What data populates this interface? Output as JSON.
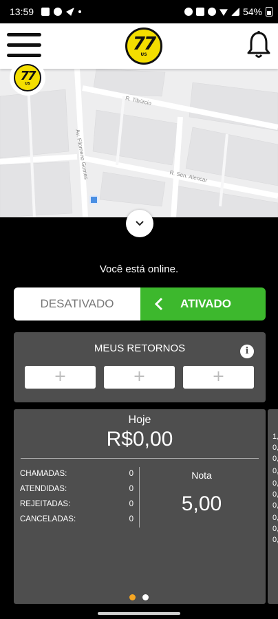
{
  "status_bar": {
    "time": "13:59",
    "battery": "54%"
  },
  "logo": {
    "number": "77",
    "sub": "US"
  },
  "map": {
    "streets": [
      "R. Tibúrcio",
      "Av. Filomeno Gomes",
      "R. Sen. Alencar"
    ]
  },
  "status": {
    "online_text": "Você está online."
  },
  "toggle": {
    "off_label": "DESATIVADO",
    "on_label": "ATIVADO",
    "active_color": "#3db82d"
  },
  "returns": {
    "title": "MEUS RETORNOS",
    "slot_symbol": "+"
  },
  "stats": {
    "period": "Hoje",
    "earnings": "R$0,00",
    "rows": [
      {
        "label": "CHAMADAS:",
        "value": "0"
      },
      {
        "label": "ATENDIDAS:",
        "value": "0"
      },
      {
        "label": "REJEITADAS:",
        "value": "0"
      },
      {
        "label": "CANCELADAS:",
        "value": "0"
      }
    ],
    "rating_label": "Nota",
    "rating_value": "5,00"
  },
  "next_card_peek": [
    "1,",
    "0,",
    "0,",
    "0,",
    "0,",
    "0,",
    "0,",
    "0,",
    "0,",
    "0,"
  ],
  "carousel": {
    "active_color": "#f5a623",
    "inactive_color": "#ffffff",
    "active_index": 0,
    "count": 2
  }
}
